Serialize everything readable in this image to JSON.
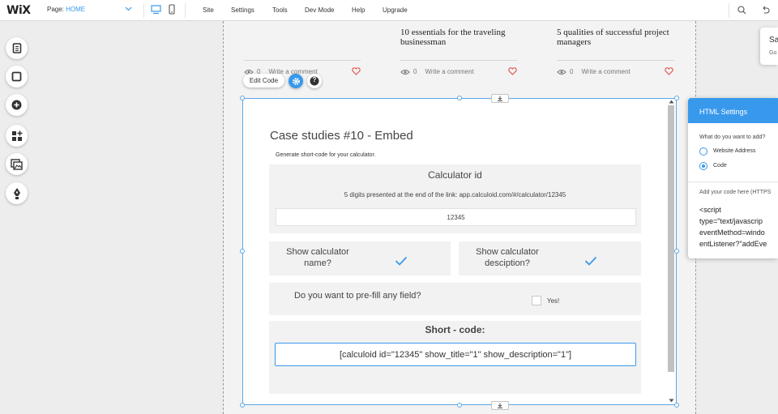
{
  "colors": {
    "accent": "#3899ec",
    "heart": "#e2504b",
    "check": "#3899ec"
  },
  "topbar": {
    "logo": "WiX",
    "page_label": "Page:",
    "page_value": "HOME",
    "menu": [
      "Site",
      "Settings",
      "Tools",
      "Dev Mode",
      "Help",
      "Upgrade"
    ]
  },
  "left_tools": [
    "pages-icon",
    "background-icon",
    "add-icon",
    "add-apps-icon",
    "media-icon",
    "pen-icon"
  ],
  "blog": {
    "posts": [
      {
        "title": "",
        "views": "0",
        "comment": "Write a comment"
      },
      {
        "title": "10 essentials for the traveling businessman",
        "views": "0",
        "comment": "Write a comment"
      },
      {
        "title": "5 qualities of successful project managers",
        "views": "0",
        "comment": "Write a comment"
      }
    ]
  },
  "edit_toolbar": {
    "edit_code": "Edit Code",
    "help": "?"
  },
  "widget": {
    "title": "Case studies #10 - Embed",
    "subtitle": "Generate short-code for your calculator.",
    "calc_id_heading": "Calculator id",
    "calc_id_hint": "5 digits presented at the end of the link: app.calculoid.com/#/calculator/12345",
    "calc_id_value": "12345",
    "show_name_label": "Show calculator name?",
    "show_name_checked": true,
    "show_desc_label": "Show calculator desciption?",
    "show_desc_checked": true,
    "prefill_label": "Do you want to pre-fill any field?",
    "prefill_option": "Yes!",
    "prefill_checked": false,
    "shortcode_heading": "Short - code:",
    "shortcode_value": "[calculoid id=\"12345\" show_title=\"1\" show_description=\"1\"]"
  },
  "html_settings": {
    "title": "HTML Settings",
    "question": "What do you want to add?",
    "options": [
      {
        "label": "Website Address",
        "selected": false
      },
      {
        "label": "Code",
        "selected": true
      }
    ],
    "code_label": "Add your code here (HTTPS",
    "code_lines": [
      "<script",
      "type=\"text/javascrip",
      "eventMethod=windo",
      "entListener?\"addEve"
    ]
  },
  "save_panel": {
    "line1": "Sa",
    "line2": "Go"
  }
}
